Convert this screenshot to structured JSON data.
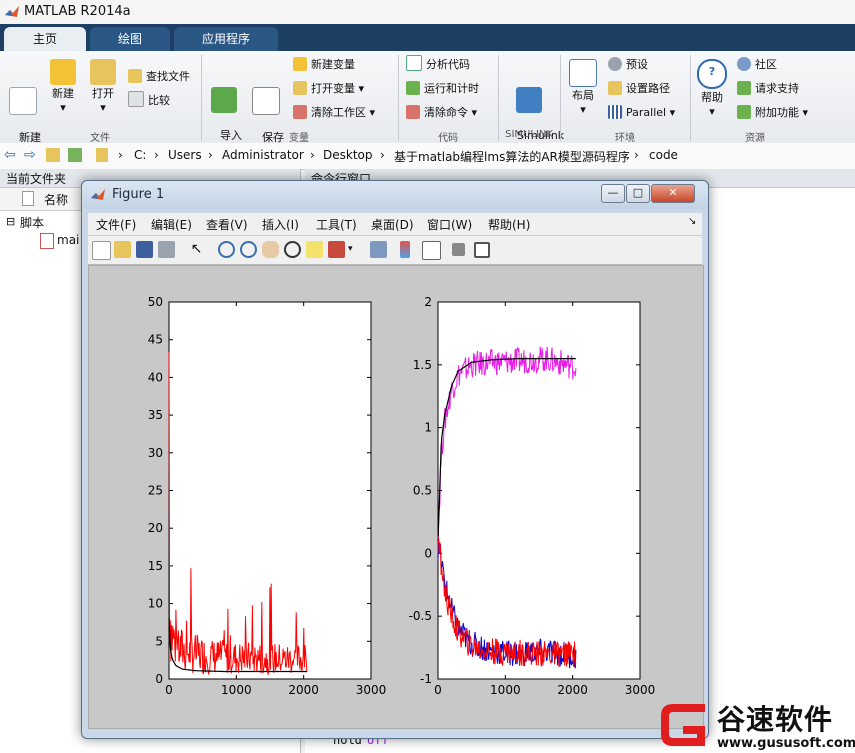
{
  "app": {
    "title": "MATLAB R2014a"
  },
  "tabs": [
    {
      "label": "主页",
      "active": true
    },
    {
      "label": "绘图",
      "active": false
    },
    {
      "label": "应用程序",
      "active": false
    }
  ],
  "ribbon": {
    "file": {
      "new_script": "新建\n脚本",
      "new": "新建",
      "open": "打开",
      "find_files": "查找文件",
      "compare": "比较",
      "group": "文件"
    },
    "variable": {
      "import": "导入\n数据",
      "save_ws": "保存\n工作区",
      "new_var": "新建变量",
      "open_var": "打开变量",
      "clear_ws": "清除工作区",
      "group": "变量"
    },
    "code": {
      "analyze": "分析代码",
      "run_time": "运行和计时",
      "clear_cmd": "清除命令",
      "group": "代码"
    },
    "simulink": {
      "lib": "Simulink\n库",
      "group": "SIMULINK"
    },
    "env": {
      "layout": "布局",
      "prefs": "预设",
      "set_path": "设置路径",
      "parallel": "Parallel",
      "group": "环境"
    },
    "res": {
      "help": "帮助",
      "community": "社区",
      "support": "请求支持",
      "addons": "附加功能",
      "group": "资源"
    }
  },
  "address": {
    "path": [
      "C:",
      "Users",
      "Administrator",
      "Desktop",
      "基于matlab编程lms算法的AR模型源码程序",
      "code"
    ]
  },
  "left_panel": {
    "title": "当前文件夹",
    "col_name": "名称",
    "group": "脚本",
    "file": "mai"
  },
  "cmd": {
    "title": "命令行窗口",
    "line_keyword": "hold",
    "line_arg": "off"
  },
  "figure": {
    "title": "Figure 1",
    "menu": [
      "文件(F)",
      "编辑(E)",
      "查看(V)",
      "插入(I)",
      "工具(T)",
      "桌面(D)",
      "窗口(W)",
      "帮助(H)"
    ],
    "win_buttons": {
      "min": "—",
      "max": "□",
      "close": "✕"
    }
  },
  "colors": {
    "ribbon_tab_bg": "#1d3f63",
    "red": "#ff0000",
    "magenta": "#e81ee8",
    "blue": "#0000d8"
  },
  "chart_data": [
    {
      "type": "line",
      "xlim": [
        0,
        3000
      ],
      "ylim": [
        0,
        50
      ],
      "xticks": [
        "0",
        "1000",
        "2000",
        "3000"
      ],
      "yticks": [
        "0",
        "5",
        "10",
        "15",
        "20",
        "25",
        "30",
        "35",
        "40",
        "45",
        "50"
      ],
      "series": [
        {
          "color": "#ff0000",
          "x": [
            0,
            5,
            10,
            20,
            40,
            80,
            150,
            300,
            600,
            1000,
            1500,
            2048
          ],
          "y": [
            44,
            20,
            12,
            8,
            6,
            5,
            4,
            3.5,
            3,
            2.8,
            2.7,
            2.6
          ]
        },
        {
          "color": "#000000",
          "x": [
            0,
            20,
            50,
            100,
            200,
            400,
            800,
            1200,
            1600,
            2048
          ],
          "y": [
            8,
            4,
            2.6,
            1.8,
            1.3,
            1.1,
            1.0,
            1.0,
            1.0,
            1.0
          ]
        }
      ],
      "grid": false
    },
    {
      "type": "line",
      "xlim": [
        0,
        3000
      ],
      "ylim": [
        -1,
        2
      ],
      "xticks": [
        "0",
        "1000",
        "2000",
        "3000"
      ],
      "yticks": [
        "-1",
        "-0.5",
        "0",
        "0.5",
        "1",
        "1.5",
        "2"
      ],
      "series": [
        {
          "color": "#e81ee8",
          "x": [
            0,
            50,
            100,
            200,
            300,
            500,
            800,
            1200,
            1600,
            2048
          ],
          "y": [
            0.1,
            0.8,
            1.05,
            1.3,
            1.42,
            1.5,
            1.52,
            1.53,
            1.55,
            1.48
          ]
        },
        {
          "color": "#000000",
          "x": [
            0,
            50,
            100,
            200,
            300,
            500,
            800,
            1200,
            1600,
            2048
          ],
          "y": [
            0.1,
            0.9,
            1.1,
            1.33,
            1.45,
            1.52,
            1.54,
            1.55,
            1.55,
            1.55
          ]
        },
        {
          "color": "#0000d8",
          "x": [
            0,
            50,
            100,
            200,
            300,
            500,
            800,
            1200,
            1600,
            2048
          ],
          "y": [
            0.05,
            -0.05,
            -0.25,
            -0.45,
            -0.6,
            -0.72,
            -0.78,
            -0.8,
            -0.78,
            -0.82
          ]
        },
        {
          "color": "#ff0000",
          "x": [
            0,
            50,
            100,
            200,
            300,
            500,
            800,
            1200,
            1600,
            2048
          ],
          "y": [
            0.1,
            -0.1,
            -0.3,
            -0.5,
            -0.63,
            -0.74,
            -0.78,
            -0.79,
            -0.8,
            -0.8
          ]
        }
      ],
      "grid": false
    }
  ],
  "watermark": {
    "brand": "谷速软件",
    "url": "www.gususoft.com"
  }
}
